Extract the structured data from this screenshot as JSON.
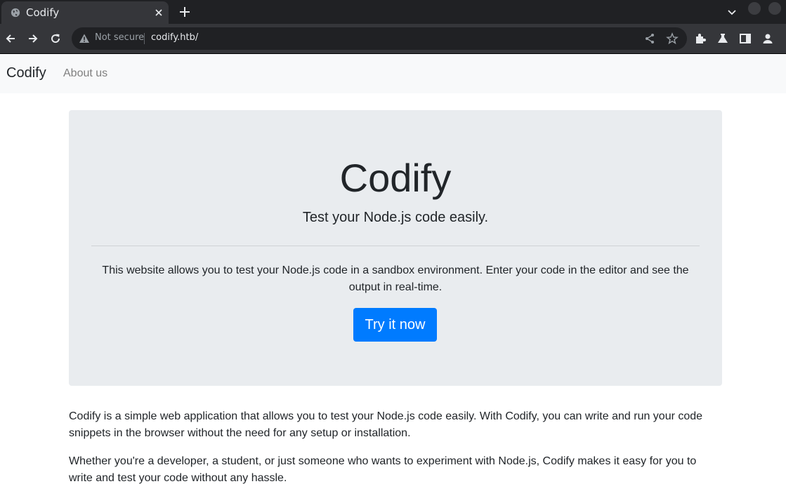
{
  "browser": {
    "tab_title": "Codify",
    "security_label": "Not secure",
    "url": "codify.htb/",
    "chrome_bg": "#202124",
    "toolbar_bg": "#35363a"
  },
  "navbar": {
    "brand": "Codify",
    "about": "About us"
  },
  "hero": {
    "title": "Codify",
    "lead": "Test your Node.js code easily.",
    "description": "This website allows you to test your Node.js code in a sandbox environment. Enter your code in the editor and see the output in real-time.",
    "button": "Try it now",
    "button_color": "#007bff"
  },
  "content": {
    "paragraph1": "Codify is a simple web application that allows you to test your Node.js code easily. With Codify, you can write and run your code snippets in the browser without the need for any setup or installation.",
    "paragraph2": "Whether you're a developer, a student, or just someone who wants to experiment with Node.js, Codify makes it easy for you to write and test your code without any hassle."
  }
}
